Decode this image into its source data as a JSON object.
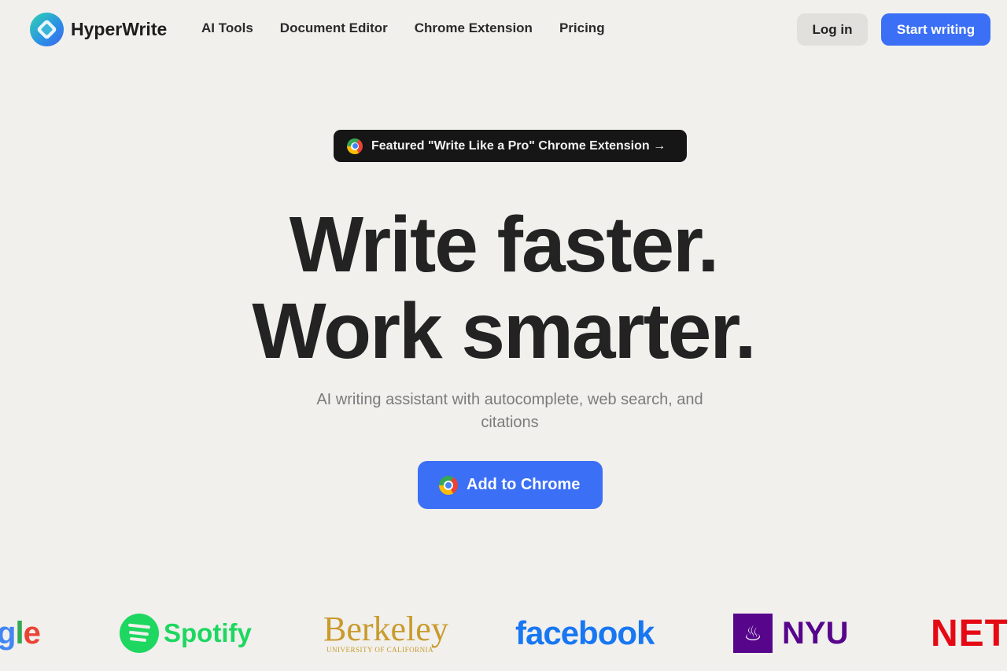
{
  "nav": {
    "brand": "HyperWrite",
    "links": [
      "AI Tools",
      "Document Editor",
      "Chrome Extension",
      "Pricing"
    ],
    "login_label": "Log in",
    "start_label": "Start writing"
  },
  "badge": {
    "label": "Featured \"Write Like a Pro\" Chrome Extension →"
  },
  "hero": {
    "title_line1": "Write faster.",
    "title_line2": "Work smarter.",
    "subtitle": "AI writing assistant with autocomplete, web search, and citations",
    "cta_label": "Add to Chrome"
  },
  "logos": {
    "google_part1": "g",
    "google_part2": "l",
    "google_part3": "e",
    "spotify": "Spotify",
    "berkeley": "Berkeley",
    "berkeley_sub": "UNIVERSITY OF CALIFORNIA",
    "facebook": "facebook",
    "nyu": "NYU",
    "netflix": "NETF"
  },
  "colors": {
    "accent": "#3b6ff5",
    "background": "#f1f0ed",
    "badge_bg": "#161616"
  }
}
